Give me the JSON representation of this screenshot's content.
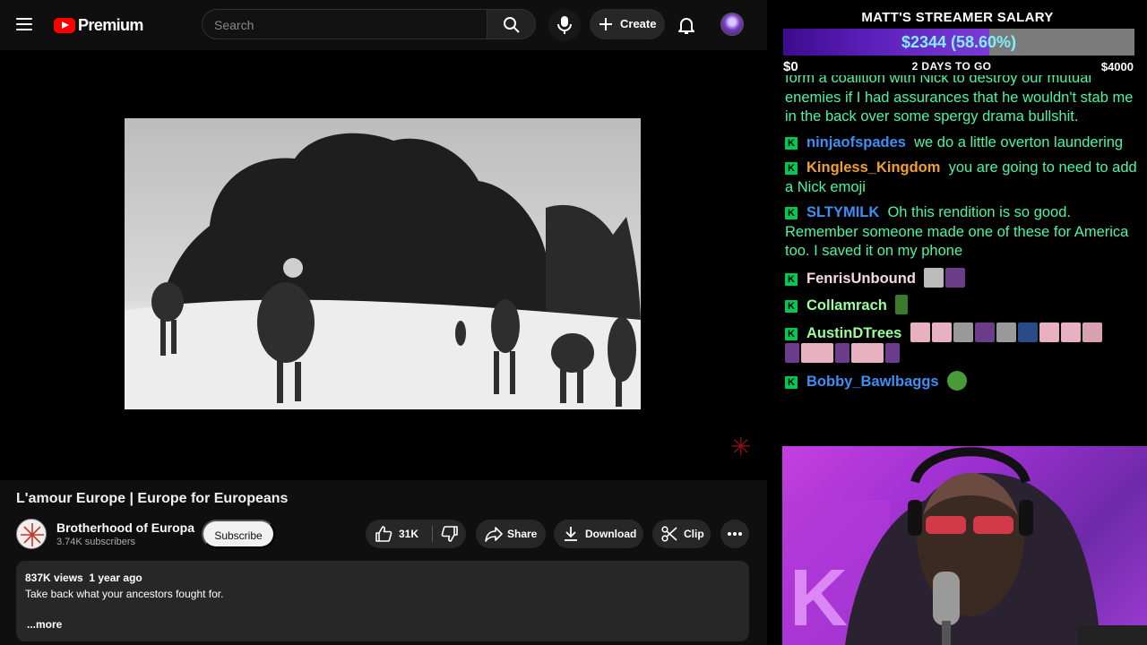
{
  "youtube": {
    "logo_text": "Premium",
    "search_placeholder": "Search",
    "create_label": "Create",
    "video_title": "L'amour Europe | Europe for Europeans",
    "channel_name": "Brotherhood of Europa",
    "subscriber_count": "3.74K subscribers",
    "subscribe_label": "Subscribe",
    "like_count": "31K",
    "share_label": "Share",
    "download_label": "Download",
    "clip_label": "Clip",
    "description_meta": "837K views  1 year ago",
    "description_text": "Take back what your ancestors fought for.",
    "more_label": "...more",
    "brand_red": "#ff0000"
  },
  "stream": {
    "goal": {
      "title": "MATT'S STREAMER SALARY",
      "amount_label": "$2344 (58.60%)",
      "progress_fraction": 0.586,
      "min_label": "$0",
      "max_label": "$4000",
      "deadline_label": "2 DAYS TO GO"
    },
    "chat": {
      "partial_message": "form a coalition with Nick to destroy our mutual enemies if I had assurances that he wouldn't stab me in the back over some spergy drama bullshit.",
      "badge": "K",
      "messages": [
        {
          "user": "ninjaofspades",
          "color": "#3d8ff5",
          "text": "we do a little overton laundering"
        },
        {
          "user": "Kingless_Kingdom",
          "color": "#f0a030",
          "text": "you are going to need to add a Nick emoji"
        },
        {
          "user": "SLTYMILK",
          "color": "#3d8ff5",
          "text": "Oh this rendition is so good. Remember someone made one of these for America too. I saved it on my phone"
        },
        {
          "user": "FenrisUnbound",
          "color": "#f3d9e6",
          "text": ""
        },
        {
          "user": "Collamrach",
          "color": "#9cff9c",
          "text": ""
        },
        {
          "user": "AustinDTrees",
          "color": "#9cff9c",
          "text": ""
        },
        {
          "user": "Bobby_Bawlbaggs",
          "color": "#3d8ff5",
          "text": ""
        }
      ]
    }
  }
}
